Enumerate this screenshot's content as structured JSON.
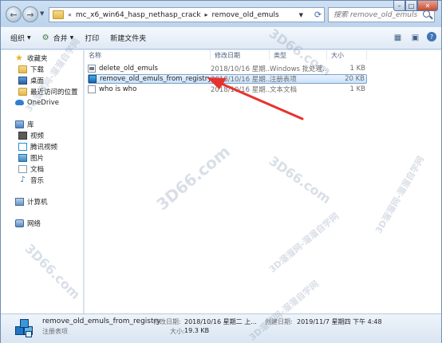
{
  "address": {
    "crumbs": [
      "mc_x6_win64_hasp_nethasp_crack",
      "remove_old_emuls"
    ],
    "search_placeholder": "搜索 remove_old_emuls"
  },
  "toolbar": {
    "organize": "组织",
    "combine": "合并",
    "print": "打印",
    "new_folder": "新建文件夹"
  },
  "nav": {
    "favorites": "收藏夹",
    "downloads": "下载",
    "desktop": "桌面",
    "recent": "最近访问的位置",
    "onedrive": "OneDrive",
    "libraries": "库",
    "videos": "视频",
    "tencent_video": "腾讯视频",
    "pictures": "图片",
    "documents": "文档",
    "music": "音乐",
    "computer": "计算机",
    "network": "网络"
  },
  "columns": {
    "name": "名称",
    "modified": "修改日期",
    "type": "类型",
    "size": "大小"
  },
  "files": [
    {
      "name": "delete_old_emuls",
      "modified": "2018/10/16 星期...",
      "type": "Windows 批处理...",
      "size": "1 KB",
      "icon": "batch-file-icon"
    },
    {
      "name": "remove_old_emuls_from_registry",
      "modified": "2018/10/16 星期...",
      "type": "注册表项",
      "size": "20 KB",
      "icon": "registry-file-icon"
    },
    {
      "name": "who is who",
      "modified": "2018/10/16 星期...",
      "type": "文本文档",
      "size": "1 KB",
      "icon": "text-file-icon"
    }
  ],
  "details": {
    "name": "remove_old_emuls_from_registry",
    "type": "注册表项",
    "modified_label": "修改日期:",
    "modified_value": "2018/10/16 星期二 上...",
    "created_label": "创建日期:",
    "created_value": "2019/11/7 星期四 下午 4:48",
    "size_label": "大小:",
    "size_value": "19.3 KB"
  },
  "watermarks": [
    "3D66.com",
    "3D66.com",
    "3D66.com",
    "3D66.com",
    "3D溜溜网-溜溜自学网",
    "3D溜溜网-溜溜自学网",
    "3D溜溜网-溜溜自学网",
    "3D溜溜网-溜溜自学网"
  ],
  "colors": {
    "selection_border": "#7da2ce",
    "arrow": "#e8322d",
    "window_frame": "#dbe7f4"
  }
}
